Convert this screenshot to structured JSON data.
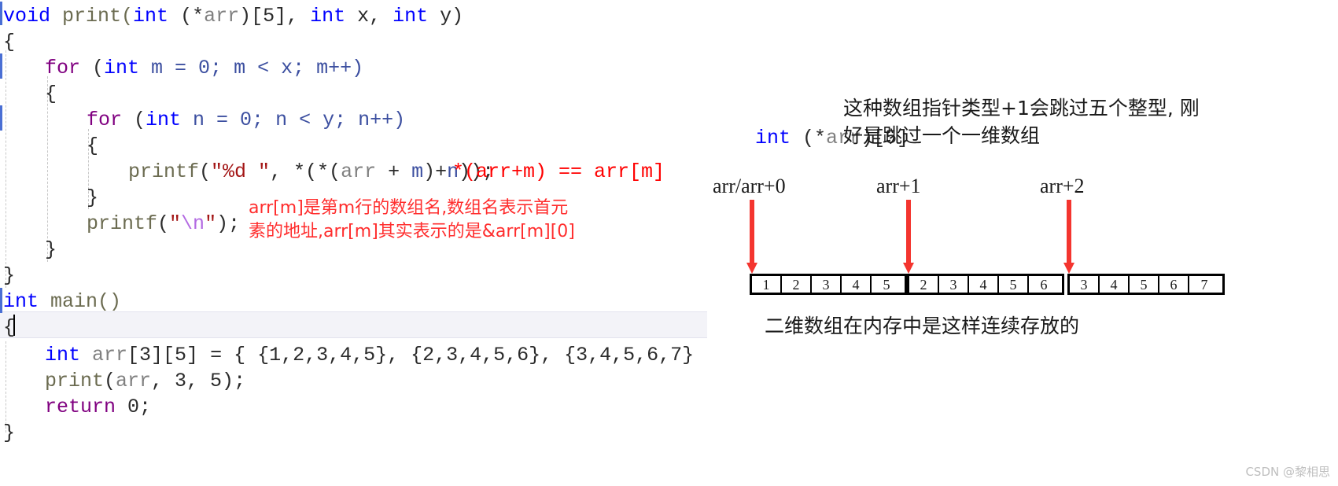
{
  "editor": {
    "language": "c",
    "current_line_number": 12,
    "cursor_visible": true,
    "code_lines": [
      {
        "indent": 0,
        "text": "void print(int (*arr)[5], int x, int y)"
      },
      {
        "indent": 0,
        "text": "{"
      },
      {
        "indent": 1,
        "text": "for (int m = 0; m < x; m++)"
      },
      {
        "indent": 1,
        "text": "{"
      },
      {
        "indent": 2,
        "text": "for (int n = 0; n < y; n++)"
      },
      {
        "indent": 2,
        "text": "{"
      },
      {
        "indent": 3,
        "text": "printf(\"%d \", *(*(arr + m)+n));"
      },
      {
        "indent": 2,
        "text": "}"
      },
      {
        "indent": 2,
        "text": "printf(\"\\n\");"
      },
      {
        "indent": 1,
        "text": "}"
      },
      {
        "indent": 0,
        "text": "}"
      },
      {
        "indent": 0,
        "text": "int main()"
      },
      {
        "indent": 0,
        "text": "{"
      },
      {
        "indent": 1,
        "text": "int arr[3][5] = { {1,2,3,4,5}, {2,3,4,5,6}, {3,4,5,6,7} };"
      },
      {
        "indent": 1,
        "text": "print(arr, 3, 5);"
      },
      {
        "indent": 1,
        "text": "return 0;"
      },
      {
        "indent": 0,
        "text": "}"
      }
    ],
    "tokens": {
      "l1": {
        "t1": "void",
        "t2": " print(",
        "t3": "int",
        "t4": " (*",
        "t5": "arr",
        "t6": ")[5], ",
        "t7": "int",
        "t8": " x, ",
        "t9": "int",
        "t10": " y)"
      },
      "l2": {
        "brace": "{"
      },
      "l3": {
        "kw": "for",
        "a": " (",
        "kw2": "int",
        "b": " m = 0; m < x; m++)"
      },
      "l4": {
        "brace": "{"
      },
      "l5": {
        "kw": "for",
        "a": " (",
        "kw2": "int",
        "b": " n = 0; n < y; n++)"
      },
      "l6": {
        "brace": "{"
      },
      "l7": {
        "fn": "printf",
        "p1": "(",
        "str": "\"%d \"",
        "p2": ", *(*(",
        "var": "arr",
        "p3": " + ",
        "m": "m",
        "p4": ")+",
        "n": "n",
        "p5": "));"
      },
      "l8": {
        "brace": "}"
      },
      "l9": {
        "fn": "printf",
        "p1": "(",
        "q1": "\"",
        "esc": "\\n",
        "q2": "\"",
        "p2": ");"
      },
      "l10": {
        "brace": "}"
      },
      "l11": {
        "brace": "}"
      },
      "l12": {
        "kw": "int",
        "rest": " main()"
      },
      "l13": {
        "brace": "{"
      },
      "l14": {
        "kw": "int",
        "sp": " ",
        "var": "arr",
        "rest": "[3][5] = { {1,2,3,4,5}, {2,3,4,5,6}, {3,4,5,6,7} };"
      },
      "l15": {
        "fn": "print",
        "p1": "(",
        "var": "arr",
        "rest": ", 3, 5);"
      },
      "l16": {
        "kw2": "return",
        "rest": " 0;"
      },
      "l17": {
        "brace": "}"
      }
    },
    "inline_annotations": [
      {
        "text": "*(arr+m) == arr[m]",
        "color": "#ff0000"
      },
      {
        "line1": "arr[m]是第m行的数组名,数组名表示首元",
        "line2": "素的地址,arr[m]其实表示的是&arr[m][0]",
        "color": "#ff2d2d"
      }
    ]
  },
  "diagram": {
    "decl": {
      "kw": "int",
      "mid": " (*",
      "var": "arr",
      "tail": ")[5]"
    },
    "note_top_line1": "这种数组指针类型+1会跳过五个整型, 刚",
    "note_top_line2": "好是跳过一个一维数组",
    "pointer_labels": [
      {
        "name": "arr/arr+0"
      },
      {
        "name": "arr+1"
      },
      {
        "name": "arr+2"
      }
    ],
    "memory_rows": [
      {
        "values": [
          "1",
          "2",
          "3",
          "4",
          "5"
        ]
      },
      {
        "values": [
          "2",
          "3",
          "4",
          "5",
          "6"
        ]
      },
      {
        "values": [
          "3",
          "4",
          "5",
          "6",
          "7"
        ]
      }
    ],
    "note_bottom": "二维数组在内存中是这样连续存放的",
    "arrow_color": "#f4352f",
    "box_border_color": "#000000"
  },
  "watermark": "CSDN @黎相思"
}
